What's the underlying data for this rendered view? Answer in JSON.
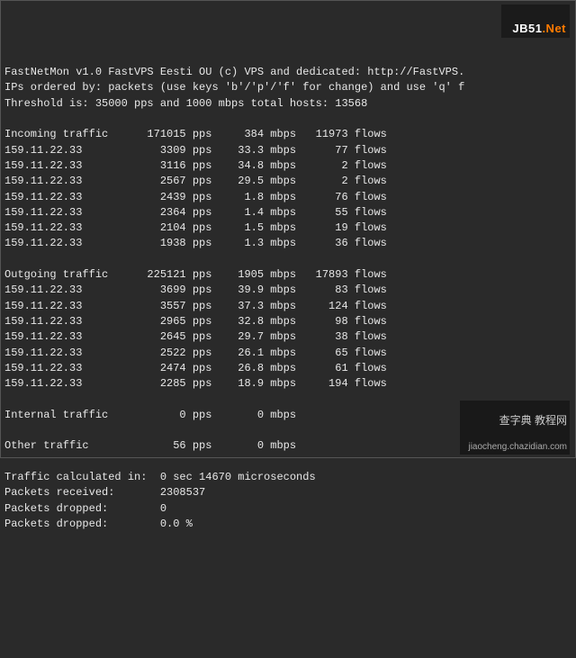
{
  "header": {
    "line1": "FastNetMon v1.0 FastVPS Eesti OU (c) VPS and dedicated: http://FastVPS.",
    "line2": "IPs ordered by: packets (use keys 'b'/'p'/'f' for change) and use 'q' f",
    "line3": "Threshold is: 35000 pps and 1000 mbps total hosts: 13568"
  },
  "sections": {
    "incoming": {
      "title": "Incoming traffic",
      "total": {
        "pps": "171015",
        "mbps": "384",
        "flows": "11973"
      },
      "rows": [
        {
          "ip": "159.11.22.33",
          "pps": "3309",
          "mbps": "33.3",
          "flows": "77"
        },
        {
          "ip": "159.11.22.33",
          "pps": "3116",
          "mbps": "34.8",
          "flows": "2"
        },
        {
          "ip": "159.11.22.33",
          "pps": "2567",
          "mbps": "29.5",
          "flows": "2"
        },
        {
          "ip": "159.11.22.33",
          "pps": "2439",
          "mbps": "1.8",
          "flows": "76"
        },
        {
          "ip": "159.11.22.33",
          "pps": "2364",
          "mbps": "1.4",
          "flows": "55"
        },
        {
          "ip": "159.11.22.33",
          "pps": "2104",
          "mbps": "1.5",
          "flows": "19"
        },
        {
          "ip": "159.11.22.33",
          "pps": "1938",
          "mbps": "1.3",
          "flows": "36"
        }
      ]
    },
    "outgoing": {
      "title": "Outgoing traffic",
      "total": {
        "pps": "225121",
        "mbps": "1905",
        "flows": "17893"
      },
      "rows": [
        {
          "ip": "159.11.22.33",
          "pps": "3699",
          "mbps": "39.9",
          "flows": "83"
        },
        {
          "ip": "159.11.22.33",
          "pps": "3557",
          "mbps": "37.3",
          "flows": "124"
        },
        {
          "ip": "159.11.22.33",
          "pps": "2965",
          "mbps": "32.8",
          "flows": "98"
        },
        {
          "ip": "159.11.22.33",
          "pps": "2645",
          "mbps": "29.7",
          "flows": "38"
        },
        {
          "ip": "159.11.22.33",
          "pps": "2522",
          "mbps": "26.1",
          "flows": "65"
        },
        {
          "ip": "159.11.22.33",
          "pps": "2474",
          "mbps": "26.8",
          "flows": "61"
        },
        {
          "ip": "159.11.22.33",
          "pps": "2285",
          "mbps": "18.9",
          "flows": "194"
        }
      ]
    },
    "internal": {
      "title": "Internal traffic",
      "pps": "0",
      "mbps": "0"
    },
    "other": {
      "title": "Other traffic",
      "pps": "56",
      "mbps": "0"
    }
  },
  "footer": {
    "calc": {
      "label": "Traffic calculated in:",
      "value": "0 sec 14670 microseconds"
    },
    "recv": {
      "label": "Packets received:",
      "value": "2308537"
    },
    "drop1": {
      "label": "Packets dropped:",
      "value": "0"
    },
    "drop2": {
      "label": "Packets dropped:",
      "value": "0.0 %"
    }
  },
  "units": {
    "pps": "pps",
    "mbps": "mbps",
    "flows": "flows"
  },
  "watermark": {
    "top_prefix": "JB51",
    "top_suffix": ".Net",
    "bot_main": "查字典 教程网",
    "bot_sub": "jiaocheng.chazidian.com"
  }
}
